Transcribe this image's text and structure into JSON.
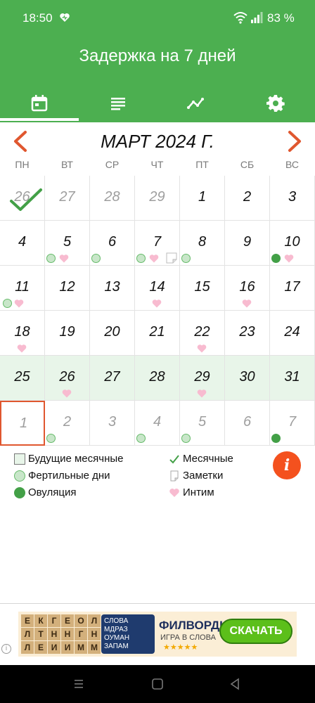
{
  "status": {
    "time": "18:50",
    "battery": "83 %"
  },
  "header": {
    "title": "Задержка на 7 дней"
  },
  "tabs": [
    {
      "name": "calendar-icon"
    },
    {
      "name": "list-icon"
    },
    {
      "name": "chart-icon"
    },
    {
      "name": "settings-icon"
    }
  ],
  "calendar": {
    "month": "МАРТ 2024 Г.",
    "weekdays": [
      "ПН",
      "ВТ",
      "СР",
      "ЧТ",
      "ПТ",
      "СБ",
      "ВС"
    ],
    "days": [
      "26",
      "27",
      "28",
      "29",
      "1",
      "2",
      "3",
      "4",
      "5",
      "6",
      "7",
      "8",
      "9",
      "10",
      "11",
      "12",
      "13",
      "14",
      "15",
      "16",
      "17",
      "18",
      "19",
      "20",
      "21",
      "22",
      "23",
      "24",
      "25",
      "26",
      "27",
      "28",
      "29",
      "30",
      "31",
      "1",
      "2",
      "3",
      "4",
      "5",
      "6",
      "7"
    ]
  },
  "legend": {
    "future_period": "Будущие месячные",
    "fertile_days": "Фертильные дни",
    "ovulation": "Овуляция",
    "period": "Месячные",
    "notes": "Заметки",
    "intimacy": "Интим"
  },
  "info_button": "i",
  "ad": {
    "tiles": [
      "Е",
      "К",
      "Г",
      "Е",
      "О",
      "Л",
      "Л",
      "Т",
      "Н",
      "Н",
      "Г",
      "Н",
      "Л",
      "Е",
      "И",
      "И",
      "М",
      "М"
    ],
    "mini_text": "СЛОВА МДРАЗ ОУМАН ЗАПАМ",
    "brand": "ФИЛВОРДЫ",
    "tagline": "ИГРА В СЛОВА",
    "stars": "★★★★★",
    "cta": "СКАЧАТЬ"
  },
  "colors": {
    "primary": "#4caf50",
    "accent": "#e0572f",
    "period_bg": "#e8f5e9"
  }
}
